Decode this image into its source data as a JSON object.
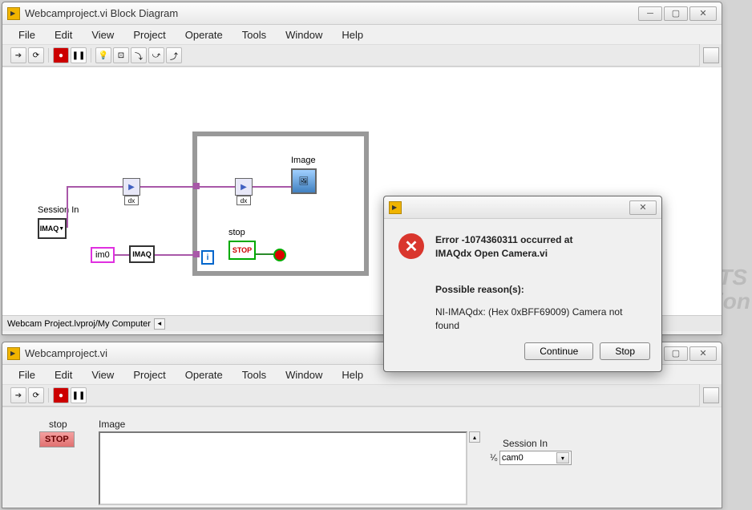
{
  "window1": {
    "title": "Webcamproject.vi Block Diagram",
    "menu": [
      "File",
      "Edit",
      "View",
      "Project",
      "Operate",
      "Tools",
      "Window",
      "Help"
    ],
    "status": "Webcam Project.lvproj/My Computer",
    "labels": {
      "session_in": "Session In",
      "imaq": "IMAQ",
      "im0": "im0",
      "imaq2": "IMAQ",
      "stop": "stop",
      "image": "Image",
      "i": "i",
      "stop_btn": "STOP"
    }
  },
  "window2": {
    "title": "Webcamproject.vi",
    "menu": [
      "File",
      "Edit",
      "View",
      "Project",
      "Operate",
      "Tools",
      "Window",
      "Help"
    ],
    "stop_label": "stop",
    "stop_btn": "STOP",
    "image_label": "Image",
    "session_label": "Session In",
    "session_prefix": "⅟₀",
    "session_value": "cam0"
  },
  "dialog": {
    "error_title_line1": "Error -1074360311 occurred at",
    "error_title_line2": "IMAQdx Open Camera.vi",
    "reason_heading": "Possible reason(s):",
    "reason_text": "NI-IMAQdx: (Hex 0xBFF69009) Camera not found",
    "continue": "Continue",
    "stop": "Stop"
  },
  "watermark1": "TS",
  "watermark2": "t Edition"
}
